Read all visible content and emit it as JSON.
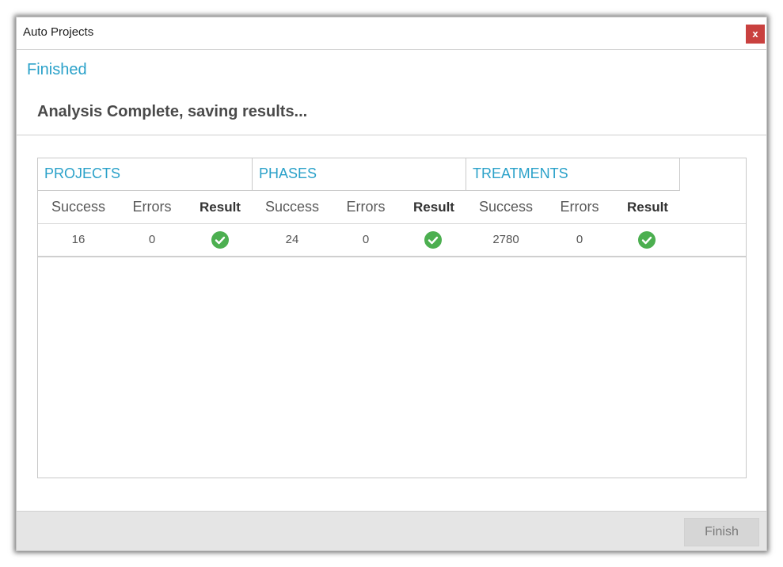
{
  "window": {
    "title": "Auto Projects",
    "close_label": "x"
  },
  "status": {
    "heading": "Finished",
    "message": "Analysis Complete, saving results..."
  },
  "grid": {
    "groups": [
      {
        "label": "PROJECTS"
      },
      {
        "label": "PHASES"
      },
      {
        "label": "TREATMENTS"
      }
    ],
    "columns": {
      "success": "Success",
      "errors": "Errors",
      "result": "Result"
    },
    "row": {
      "projects": {
        "success": "16",
        "errors": "0",
        "result_icon": "check-circle-icon"
      },
      "phases": {
        "success": "24",
        "errors": "0",
        "result_icon": "check-circle-icon"
      },
      "treatments": {
        "success": "2780",
        "errors": "0",
        "result_icon": "check-circle-icon"
      }
    }
  },
  "footer": {
    "finish_label": "Finish"
  },
  "colors": {
    "accent": "#2aa1c9",
    "close": "#c9413f",
    "success": "#4caf50"
  }
}
